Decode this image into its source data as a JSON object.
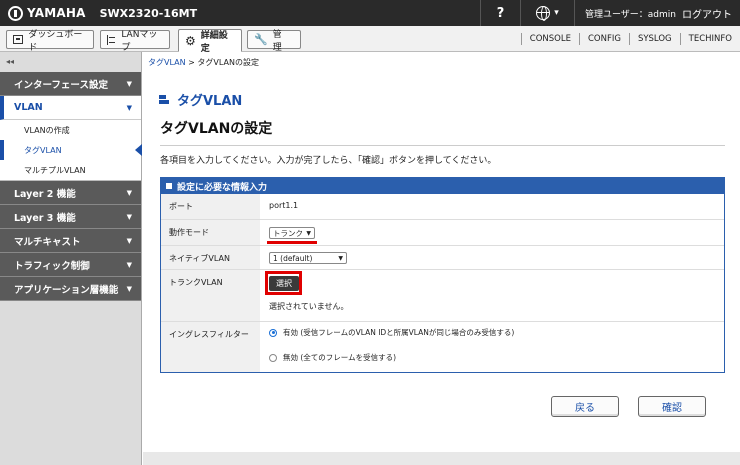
{
  "topbar": {
    "brand": "YAMAHA",
    "model": "SWX2320-16MT",
    "help": "?",
    "user_label": "管理ユーザー：admin",
    "logout": "ログアウト"
  },
  "tabs": [
    {
      "label": "ダッシュボード",
      "icon": "dashboard-icon"
    },
    {
      "label": "LANマップ",
      "icon": "lan-map-icon"
    },
    {
      "label": "詳細設定",
      "icon": "gear-icon",
      "active": true
    },
    {
      "label": "管　理",
      "icon": "wrench-icon"
    }
  ],
  "right_links": [
    "CONSOLE",
    "CONFIG",
    "SYSLOG",
    "TECHINFO"
  ],
  "sidebar": {
    "collapse": "◂◂",
    "groups": [
      {
        "label": "インターフェース設定"
      },
      {
        "label": "VLAN",
        "open": true,
        "items": [
          {
            "label": "VLANの作成"
          },
          {
            "label": "タグVLAN",
            "active": true
          },
          {
            "label": "マルチプルVLAN"
          }
        ]
      },
      {
        "label": "Layer 2 機能"
      },
      {
        "label": "Layer 3 機能"
      },
      {
        "label": "マルチキャスト"
      },
      {
        "label": "トラフィック制御"
      },
      {
        "label": "アプリケーション層機能"
      }
    ]
  },
  "breadcrumb": {
    "parent": "タグVLAN",
    "sep": ">",
    "current": "タグVLANの設定"
  },
  "section_title": "タグVLAN",
  "page_title": "タグVLANの設定",
  "instruction": "各項目を入力してください。入力が完了したら、「確認」ボタンを押してください。",
  "panel": {
    "title": "設定に必要な情報入力",
    "rows": {
      "port": {
        "label": "ポート",
        "value": "port1.1"
      },
      "mode": {
        "label": "動作モード",
        "value": "トランク"
      },
      "native": {
        "label": "ネイティブVLAN",
        "value": "1 (default)"
      },
      "trunk": {
        "label": "トランクVLAN",
        "button": "選択",
        "note": "選択されていません。"
      },
      "ingress": {
        "label": "イングレスフィルター",
        "option_on": "有効 (受信フレームのVLAN IDと所属VLANが同じ場合のみ受信する)",
        "option_off": "無効 (全てのフレームを受信する)",
        "selected": "有効"
      }
    }
  },
  "buttons": {
    "back": "戻る",
    "confirm": "確認"
  },
  "colors": {
    "accent": "#1a4fa8",
    "highlight": "#e00000",
    "topbar": "#2a2a2a"
  }
}
